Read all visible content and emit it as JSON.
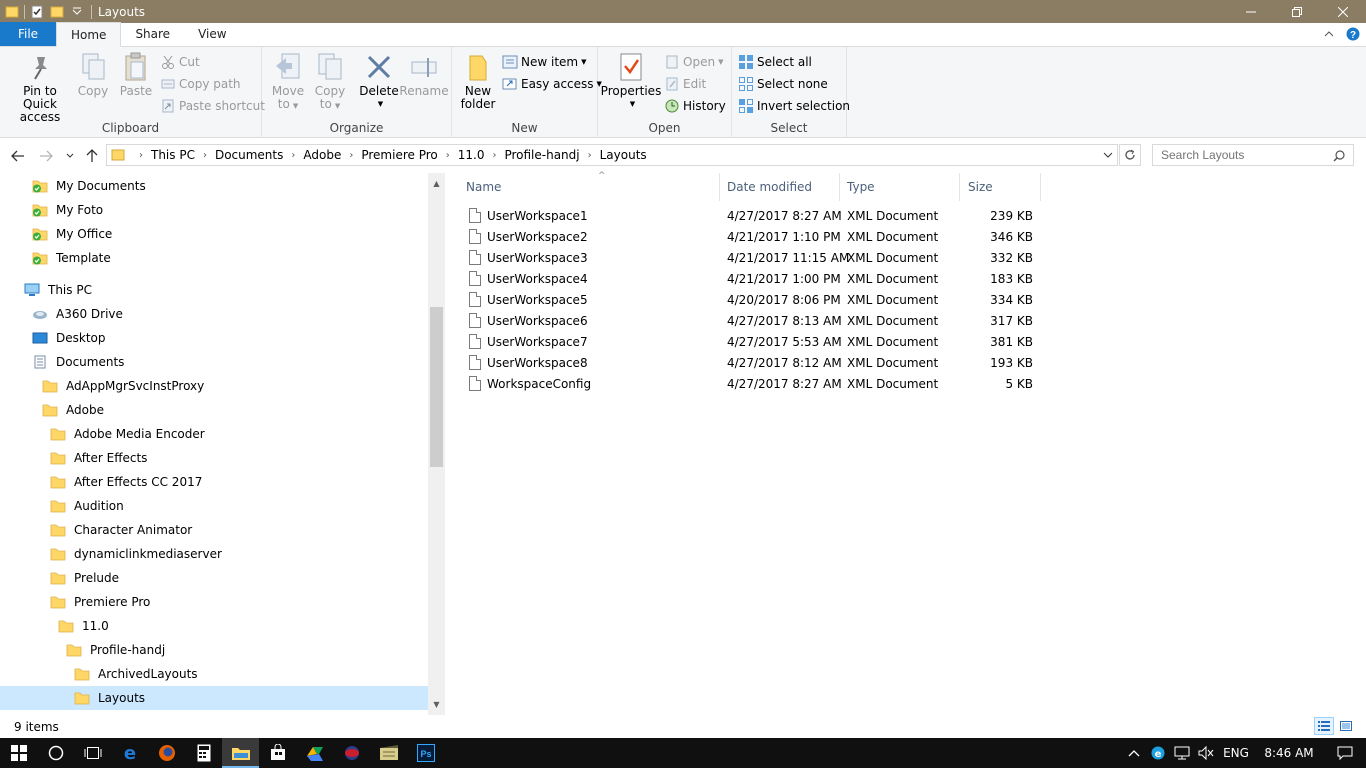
{
  "window": {
    "title": "Layouts",
    "controls": [
      "minimize",
      "restore",
      "close"
    ]
  },
  "ribbon_tabs": {
    "file": "File",
    "home": "Home",
    "share": "Share",
    "view": "View"
  },
  "ribbon": {
    "clipboard": {
      "label": "Clipboard",
      "pin": "Pin to Quick access",
      "pin_l1": "Pin to Quick",
      "pin_l2": "access",
      "copy": "Copy",
      "paste": "Paste",
      "cut": "Cut",
      "copy_path": "Copy path",
      "paste_shortcut": "Paste shortcut"
    },
    "organize": {
      "label": "Organize",
      "move_to_l1": "Move",
      "move_to_l2": "to",
      "copy_to_l1": "Copy",
      "copy_to_l2": "to",
      "delete": "Delete",
      "rename": "Rename"
    },
    "new": {
      "label": "New",
      "new_folder_l1": "New",
      "new_folder_l2": "folder",
      "new_item": "New item",
      "easy_access": "Easy access"
    },
    "open": {
      "label": "Open",
      "properties": "Properties",
      "open": "Open",
      "edit": "Edit",
      "history": "History"
    },
    "select": {
      "label": "Select",
      "select_all": "Select all",
      "select_none": "Select none",
      "invert": "Invert selection"
    }
  },
  "address": {
    "crumbs": [
      "This PC",
      "Documents",
      "Adobe",
      "Premiere Pro",
      "11.0",
      "Profile-handj",
      "Layouts"
    ],
    "search_placeholder": "Search Layouts"
  },
  "tree": [
    {
      "label": "My Documents",
      "indent": 0,
      "kind": "synced"
    },
    {
      "label": "My Foto",
      "indent": 0,
      "kind": "synced"
    },
    {
      "label": "My Office",
      "indent": 0,
      "kind": "synced"
    },
    {
      "label": "Template",
      "indent": 0,
      "kind": "synced"
    },
    {
      "label": "This PC",
      "indent": -1,
      "kind": "pc"
    },
    {
      "label": "A360 Drive",
      "indent": 0,
      "kind": "cloud"
    },
    {
      "label": "Desktop",
      "indent": 0,
      "kind": "desktop"
    },
    {
      "label": "Documents",
      "indent": 0,
      "kind": "docs"
    },
    {
      "label": "AdAppMgrSvcInstProxy",
      "indent": 1,
      "kind": "folder"
    },
    {
      "label": "Adobe",
      "indent": 1,
      "kind": "folder"
    },
    {
      "label": "Adobe Media Encoder",
      "indent": 2,
      "kind": "folder"
    },
    {
      "label": "After Effects",
      "indent": 2,
      "kind": "folder"
    },
    {
      "label": "After Effects CC 2017",
      "indent": 2,
      "kind": "folder"
    },
    {
      "label": "Audition",
      "indent": 2,
      "kind": "folder"
    },
    {
      "label": "Character Animator",
      "indent": 2,
      "kind": "folder"
    },
    {
      "label": "dynamiclinkmediaserver",
      "indent": 2,
      "kind": "folder"
    },
    {
      "label": "Prelude",
      "indent": 2,
      "kind": "folder"
    },
    {
      "label": "Premiere Pro",
      "indent": 2,
      "kind": "folder"
    },
    {
      "label": "11.0",
      "indent": 3,
      "kind": "folder"
    },
    {
      "label": "Profile-handj",
      "indent": 4,
      "kind": "folder"
    },
    {
      "label": "ArchivedLayouts",
      "indent": 5,
      "kind": "folder"
    },
    {
      "label": "Layouts",
      "indent": 5,
      "kind": "folder",
      "selected": true
    }
  ],
  "columns": {
    "name": "Name",
    "date": "Date modified",
    "type": "Type",
    "size": "Size"
  },
  "files": [
    {
      "name": "UserWorkspace1",
      "date": "4/27/2017 8:27 AM",
      "type": "XML Document",
      "size": "239 KB"
    },
    {
      "name": "UserWorkspace2",
      "date": "4/21/2017 1:10 PM",
      "type": "XML Document",
      "size": "346 KB"
    },
    {
      "name": "UserWorkspace3",
      "date": "4/21/2017 11:15 AM",
      "type": "XML Document",
      "size": "332 KB"
    },
    {
      "name": "UserWorkspace4",
      "date": "4/21/2017 1:00 PM",
      "type": "XML Document",
      "size": "183 KB"
    },
    {
      "name": "UserWorkspace5",
      "date": "4/20/2017 8:06 PM",
      "type": "XML Document",
      "size": "334 KB"
    },
    {
      "name": "UserWorkspace6",
      "date": "4/27/2017 8:13 AM",
      "type": "XML Document",
      "size": "317 KB"
    },
    {
      "name": "UserWorkspace7",
      "date": "4/27/2017 5:53 AM",
      "type": "XML Document",
      "size": "381 KB"
    },
    {
      "name": "UserWorkspace8",
      "date": "4/27/2017 8:12 AM",
      "type": "XML Document",
      "size": "193 KB"
    },
    {
      "name": "WorkspaceConfig",
      "date": "4/27/2017 8:27 AM",
      "type": "XML Document",
      "size": "5 KB"
    }
  ],
  "status": {
    "count": "9 items"
  },
  "taskbar": {
    "apps": [
      "start",
      "cortana",
      "task-view",
      "edge",
      "firefox",
      "calculator",
      "file-explorer",
      "store",
      "app-a",
      "app-b",
      "app-c",
      "photoshop"
    ],
    "language": "ENG",
    "time": "8:46 AM",
    "ps_label": "Ps"
  },
  "colors": {
    "titlebar": "#8b7d63",
    "file_tab": "#1979ca",
    "folder": "#ffd766",
    "selection": "#cce8ff",
    "sync_green": "#3aae3a"
  }
}
